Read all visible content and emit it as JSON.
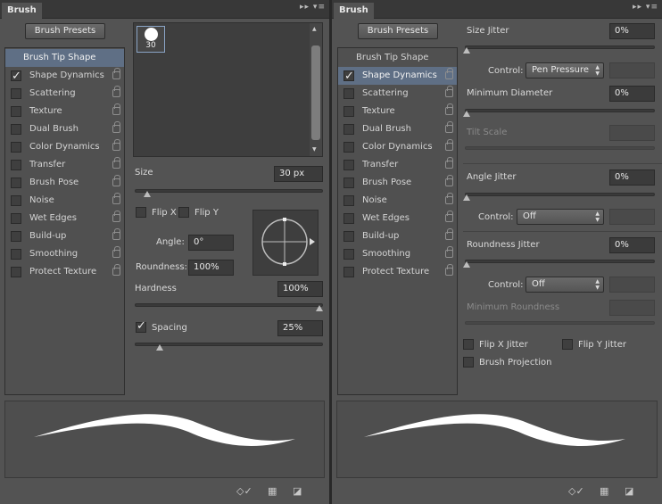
{
  "left": {
    "tab": "Brush",
    "presets_button": "Brush Presets",
    "list": {
      "header": "Brush Tip Shape",
      "items": [
        {
          "label": "Shape Dynamics",
          "checked": true
        },
        {
          "label": "Scattering",
          "checked": false
        },
        {
          "label": "Texture",
          "checked": false
        },
        {
          "label": "Dual Brush",
          "checked": false
        },
        {
          "label": "Color Dynamics",
          "checked": false
        },
        {
          "label": "Transfer",
          "checked": false
        },
        {
          "label": "Brush Pose",
          "checked": false
        },
        {
          "label": "Noise",
          "checked": false
        },
        {
          "label": "Wet Edges",
          "checked": false
        },
        {
          "label": "Build-up",
          "checked": false
        },
        {
          "label": "Smoothing",
          "checked": false
        },
        {
          "label": "Protect Texture",
          "checked": false
        }
      ]
    },
    "tip_size": "30",
    "size": {
      "label": "Size",
      "value": "30 px",
      "slider": 0.05
    },
    "flip_x": {
      "label": "Flip X",
      "checked": false
    },
    "flip_y": {
      "label": "Flip Y",
      "checked": false
    },
    "angle": {
      "label": "Angle:",
      "value": "0°"
    },
    "roundness": {
      "label": "Roundness:",
      "value": "100%"
    },
    "hardness": {
      "label": "Hardness",
      "value": "100%",
      "slider": 1.0
    },
    "spacing": {
      "label": "Spacing",
      "value": "25%",
      "checked": true,
      "slider": 0.12
    }
  },
  "right": {
    "tab": "Brush",
    "presets_button": "Brush Presets",
    "list": {
      "header": "Brush Tip Shape",
      "items": [
        {
          "label": "Shape Dynamics",
          "checked": true
        },
        {
          "label": "Scattering",
          "checked": false
        },
        {
          "label": "Texture",
          "checked": false
        },
        {
          "label": "Dual Brush",
          "checked": false
        },
        {
          "label": "Color Dynamics",
          "checked": false
        },
        {
          "label": "Transfer",
          "checked": false
        },
        {
          "label": "Brush Pose",
          "checked": false
        },
        {
          "label": "Noise",
          "checked": false
        },
        {
          "label": "Wet Edges",
          "checked": false
        },
        {
          "label": "Build-up",
          "checked": false
        },
        {
          "label": "Smoothing",
          "checked": false
        },
        {
          "label": "Protect Texture",
          "checked": false
        }
      ]
    },
    "size_jitter": {
      "label": "Size Jitter",
      "value": "0%",
      "slider": 0
    },
    "size_control": {
      "label": "Control:",
      "value": "Pen Pressure"
    },
    "min_diameter": {
      "label": "Minimum Diameter",
      "value": "0%",
      "slider": 0
    },
    "tilt_scale": {
      "label": "Tilt Scale",
      "value": ""
    },
    "angle_jitter": {
      "label": "Angle Jitter",
      "value": "0%",
      "slider": 0
    },
    "angle_control": {
      "label": "Control:",
      "value": "Off"
    },
    "roundness_jitter": {
      "label": "Roundness Jitter",
      "value": "0%",
      "slider": 0
    },
    "roundness_control": {
      "label": "Control:",
      "value": "Off"
    },
    "min_roundness": {
      "label": "Minimum Roundness",
      "value": ""
    },
    "flip_x_jitter": {
      "label": "Flip X Jitter",
      "checked": false
    },
    "flip_y_jitter": {
      "label": "Flip Y Jitter",
      "checked": false
    },
    "brush_projection": {
      "label": "Brush Projection",
      "checked": false
    }
  }
}
